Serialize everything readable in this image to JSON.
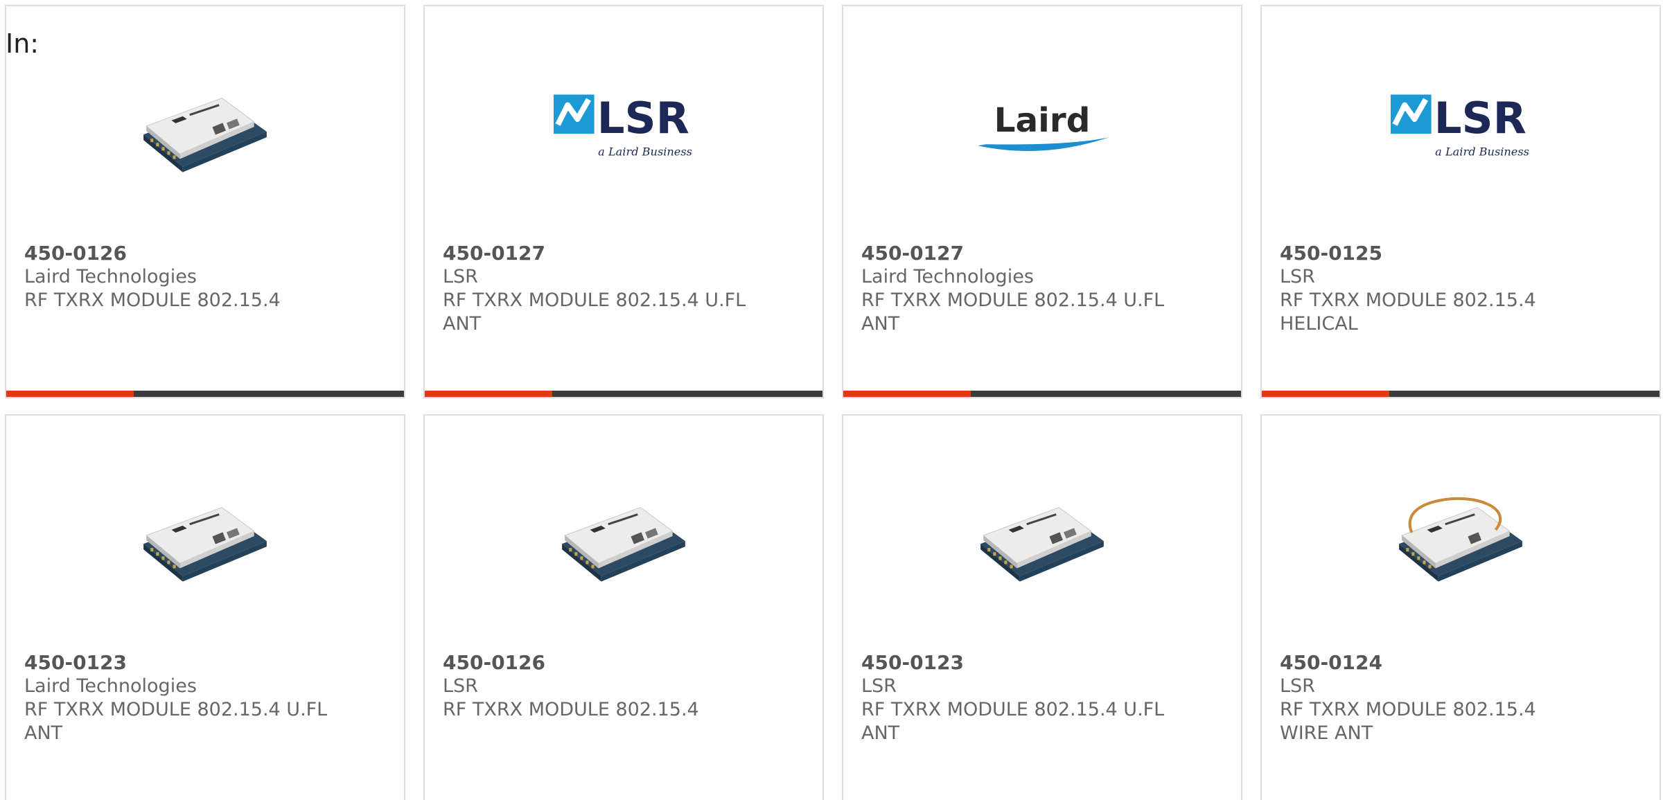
{
  "header": {
    "label": "In:"
  },
  "colors": {
    "accent": "#e03a10",
    "bar_track": "#3b3b3b",
    "card_border": "#dddddd",
    "lsr_blue": "#1c9ad6",
    "lsr_navy": "#1d2856",
    "laird_swoosh": "#1d8fd0"
  },
  "products": [
    {
      "part": "450-0126",
      "manufacturer": "Laird Technologies",
      "description": "RF TXRX MODULE 802.15.4",
      "image": "rf-module-photo",
      "progress": 0.32
    },
    {
      "part": "450-0127",
      "manufacturer": "LSR",
      "description": "RF TXRX MODULE 802.15.4 U.FL ANT",
      "image": "lsr-logo",
      "logo_main": "LSR",
      "logo_sub": "a Laird Business",
      "progress": 0.32
    },
    {
      "part": "450-0127",
      "manufacturer": "Laird Technologies",
      "description": "RF TXRX MODULE 802.15.4 U.FL ANT",
      "image": "laird-logo",
      "logo_main": "Laird",
      "progress": 0.32
    },
    {
      "part": "450-0125",
      "manufacturer": "LSR",
      "description": "RF TXRX MODULE 802.15.4 HELICAL",
      "image": "lsr-logo",
      "logo_main": "LSR",
      "logo_sub": "a Laird Business",
      "progress": 0.32
    },
    {
      "part": "450-0123",
      "manufacturer": "Laird Technologies",
      "description": "RF TXRX MODULE 802.15.4 U.FL ANT",
      "image": "rf-module-photo"
    },
    {
      "part": "450-0126",
      "manufacturer": "LSR",
      "description": "RF TXRX MODULE 802.15.4",
      "image": "rf-module-photo"
    },
    {
      "part": "450-0123",
      "manufacturer": "LSR",
      "description": "RF TXRX MODULE 802.15.4 U.FL ANT",
      "image": "rf-module-photo"
    },
    {
      "part": "450-0124",
      "manufacturer": "LSR",
      "description": "RF TXRX MODULE 802.15.4 WIRE ANT",
      "image": "rf-module-wire-antenna-photo"
    }
  ]
}
